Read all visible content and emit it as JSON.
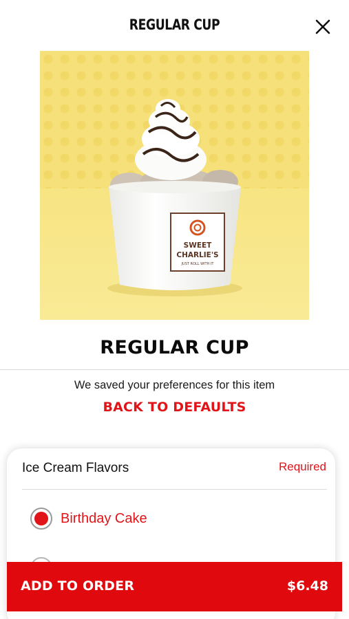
{
  "header": {
    "title": "REGULAR CUP",
    "close_icon": "close-icon"
  },
  "product": {
    "title": "REGULAR CUP",
    "image_alt": "sweet-charlies-cup-photo",
    "cup_logo_line1": "SWEET",
    "cup_logo_line2": "CHARLIE'S",
    "cup_logo_tagline": "JUST ROLL WITH IT"
  },
  "preferences": {
    "note": "We saved your preferences for this item",
    "back_to_defaults": "BACK TO DEFAULTS"
  },
  "flavors": {
    "title": "Ice Cream Flavors",
    "required": "Required",
    "options": [
      {
        "label": "Birthday Cake",
        "selected": true
      }
    ]
  },
  "footer": {
    "add_label": "ADD TO ORDER",
    "price": "$6.48"
  },
  "colors": {
    "accent": "#e01419",
    "button": "#e00a0e",
    "hero_bg": "#f6e27f"
  }
}
